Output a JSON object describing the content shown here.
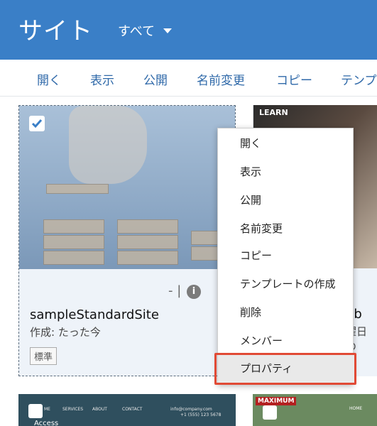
{
  "header": {
    "title": "サイト",
    "filter_label": "すべて"
  },
  "toolbar": {
    "items": [
      "開く",
      "表示",
      "公開",
      "名前変更",
      "コピー",
      "テンプ"
    ]
  },
  "cards": [
    {
      "name": "sampleStandardSite",
      "meta": "作成: たった今",
      "badge": "標準",
      "toolbar_text": "-   |"
    },
    {
      "image_label": "LEARN",
      "name": "ub",
      "meta": "曜日の"
    },
    {
      "nav_items": [
        "ME",
        "SERVICES",
        "ABOUT",
        "CONTACT",
        "info@company.com",
        "+1 (555) 123 5678"
      ],
      "title": "Access"
    },
    {
      "brand": "MAXIMUM",
      "nav": "HOME"
    }
  ],
  "context_menu": {
    "items": [
      "開く",
      "表示",
      "公開",
      "名前変更",
      "コピー",
      "テンプレートの作成",
      "削除",
      "メンバー",
      "プロパティ"
    ],
    "selected_index": 8,
    "highlight_color": "#e14a35"
  },
  "colors": {
    "header_bg": "#3a7fc7",
    "link": "#2f69a9"
  }
}
